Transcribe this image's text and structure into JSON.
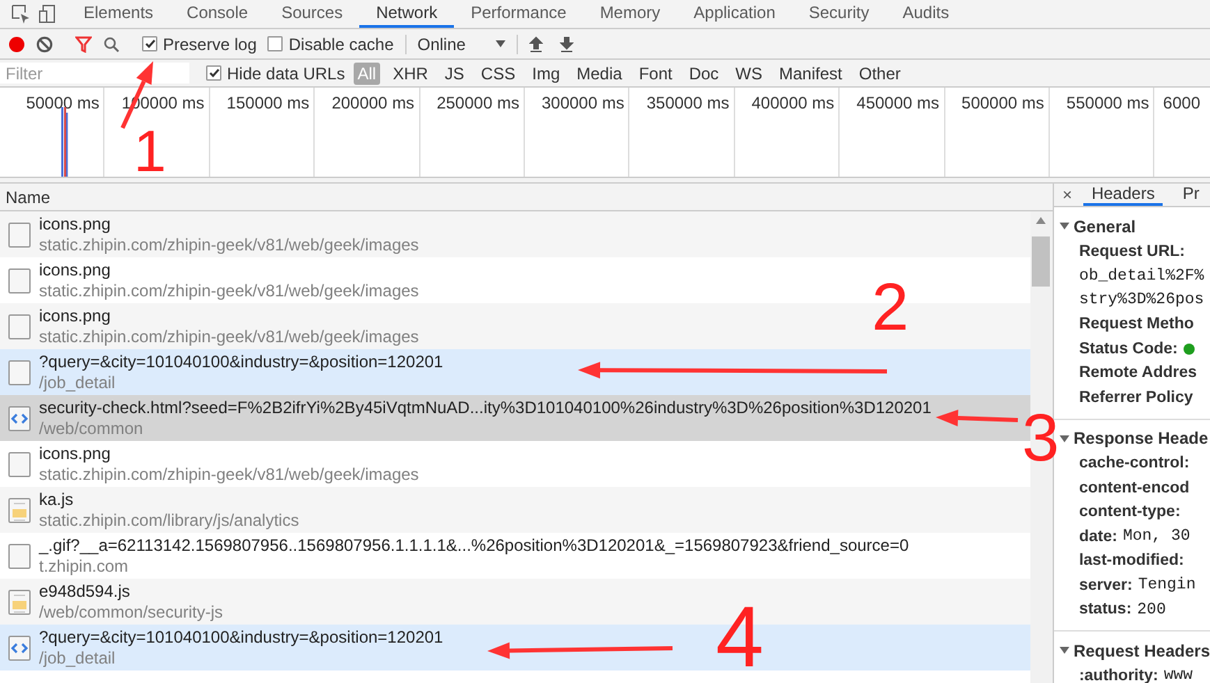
{
  "panel_tabs": [
    {
      "label": "Elements",
      "selected": false
    },
    {
      "label": "Console",
      "selected": false
    },
    {
      "label": "Sources",
      "selected": false
    },
    {
      "label": "Network",
      "selected": true
    },
    {
      "label": "Performance",
      "selected": false
    },
    {
      "label": "Memory",
      "selected": false
    },
    {
      "label": "Application",
      "selected": false
    },
    {
      "label": "Security",
      "selected": false
    },
    {
      "label": "Audits",
      "selected": false
    }
  ],
  "toolbar": {
    "recording": true,
    "preserve_log": {
      "label": "Preserve log",
      "checked": true
    },
    "disable_cache": {
      "label": "Disable cache",
      "checked": false
    },
    "throttling": "Online"
  },
  "filter_bar": {
    "placeholder": "Filter",
    "hide_data_urls": {
      "label": "Hide data URLs",
      "checked": true
    },
    "types": [
      {
        "label": "All",
        "selected": true
      },
      {
        "label": "XHR",
        "selected": false
      },
      {
        "label": "JS",
        "selected": false
      },
      {
        "label": "CSS",
        "selected": false
      },
      {
        "label": "Img",
        "selected": false
      },
      {
        "label": "Media",
        "selected": false
      },
      {
        "label": "Font",
        "selected": false
      },
      {
        "label": "Doc",
        "selected": false
      },
      {
        "label": "WS",
        "selected": false
      },
      {
        "label": "Manifest",
        "selected": false
      },
      {
        "label": "Other",
        "selected": false
      }
    ]
  },
  "overview": {
    "ticks": [
      "50000 ms",
      "100000 ms",
      "150000 ms",
      "200000 ms",
      "250000 ms",
      "300000 ms",
      "350000 ms",
      "400000 ms",
      "450000 ms",
      "500000 ms",
      "550000 ms",
      "6000"
    ]
  },
  "requests": {
    "column": "Name",
    "rows": [
      {
        "kind": "image",
        "name": "icons.png",
        "path": "static.zhipin.com/zhipin-geek/v81/web/geek/images",
        "selected": false,
        "highlighted": false
      },
      {
        "kind": "image",
        "name": "icons.png",
        "path": "static.zhipin.com/zhipin-geek/v81/web/geek/images",
        "selected": false,
        "highlighted": false
      },
      {
        "kind": "image",
        "name": "icons.png",
        "path": "static.zhipin.com/zhipin-geek/v81/web/geek/images",
        "selected": false,
        "highlighted": false
      },
      {
        "kind": "image",
        "name": "?query=&city=101040100&industry=&position=120201",
        "path": "/job_detail",
        "selected": false,
        "highlighted": true
      },
      {
        "kind": "document",
        "name": "security-check.html?seed=F%2B2ifrYi%2By45iVqtmNuAD...ity%3D101040100%26industry%3D%26position%3D120201",
        "path": "/web/common",
        "selected": true,
        "highlighted": false
      },
      {
        "kind": "image",
        "name": "icons.png",
        "path": "static.zhipin.com/zhipin-geek/v81/web/geek/images",
        "selected": false,
        "highlighted": false
      },
      {
        "kind": "script",
        "name": "ka.js",
        "path": "static.zhipin.com/library/js/analytics",
        "selected": false,
        "highlighted": false
      },
      {
        "kind": "image",
        "name": "_.gif?__a=62113142.1569807956..1569807956.1.1.1.1&...%26position%3D120201&_=1569807923&friend_source=0",
        "path": "t.zhipin.com",
        "selected": false,
        "highlighted": false
      },
      {
        "kind": "script",
        "name": "e948d594.js",
        "path": "/web/common/security-js",
        "selected": false,
        "highlighted": false
      },
      {
        "kind": "document",
        "name": "?query=&city=101040100&industry=&position=120201",
        "path": "/job_detail",
        "selected": false,
        "highlighted": true
      }
    ]
  },
  "details": {
    "close": "×",
    "tabs": [
      {
        "label": "Headers",
        "selected": true
      },
      {
        "label": "Pr",
        "selected": false
      }
    ],
    "sections": [
      {
        "title": "General",
        "expanded": true,
        "items": [
          {
            "kind": "header",
            "name": "Request URL:"
          },
          {
            "kind": "wrap",
            "text": "ob_detail%2F%"
          },
          {
            "kind": "wrap",
            "text": "stry%3D%26pos"
          },
          {
            "kind": "header",
            "name": "Request Metho"
          },
          {
            "kind": "status",
            "name": "Status Code:"
          },
          {
            "kind": "header",
            "name": "Remote Addres"
          },
          {
            "kind": "header",
            "name": "Referrer Policy"
          }
        ]
      },
      {
        "title": "Response Heade",
        "expanded": true,
        "items": [
          {
            "kind": "header",
            "name": "cache-control:"
          },
          {
            "kind": "header",
            "name": "content-encod"
          },
          {
            "kind": "header",
            "name": "content-type:"
          },
          {
            "kind": "header",
            "name": "date:",
            "value": "Mon, 30"
          },
          {
            "kind": "header",
            "name": "last-modified:"
          },
          {
            "kind": "header",
            "name": "server:",
            "value": "Tengin"
          },
          {
            "kind": "header",
            "name": "status:",
            "value": "200"
          }
        ]
      },
      {
        "title": "Request Headers",
        "expanded": true,
        "items": [
          {
            "kind": "header",
            "name": ":authority:",
            "value": "www"
          }
        ]
      }
    ]
  },
  "annotations": [
    {
      "label": "1"
    },
    {
      "label": "2"
    },
    {
      "label": "3"
    },
    {
      "label": "4"
    }
  ]
}
